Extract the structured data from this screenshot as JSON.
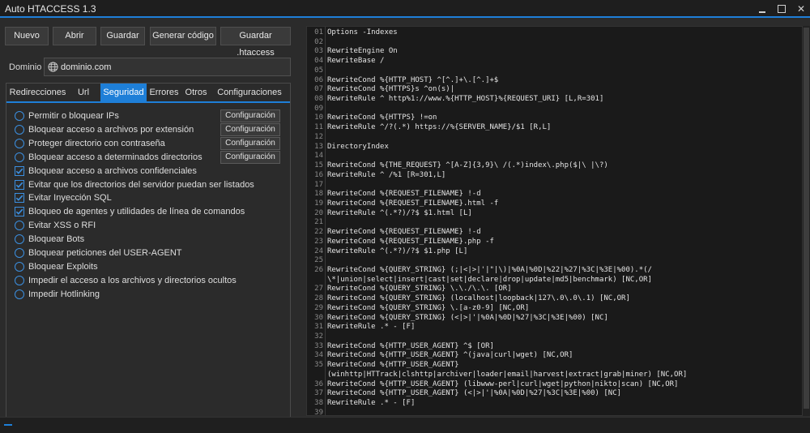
{
  "window": {
    "title": "Auto HTACCESS 1.3"
  },
  "toolbar": {
    "buttons": [
      "Nuevo",
      "Abrir",
      "Guardar",
      "Generar código",
      "Guardar .htaccess"
    ]
  },
  "dominio": {
    "label": "Dominio",
    "value": "dominio.com"
  },
  "tabs": [
    "Redirecciones",
    "Url",
    "Seguridad",
    "Errores",
    "Otros",
    "Configuraciones"
  ],
  "active_tab": "Seguridad",
  "security_options": [
    {
      "label": "Permitir o bloquear IPs",
      "checked": false,
      "config": "Configuración"
    },
    {
      "label": "Bloquear acceso a archivos por extensión",
      "checked": false,
      "config": "Configuración"
    },
    {
      "label": "Proteger directorio con contraseña",
      "checked": false,
      "config": "Configuración"
    },
    {
      "label": "Bloquear acceso a determinados directorios",
      "checked": false,
      "config": "Configuración"
    },
    {
      "label": "Bloquear acceso a archivos confidenciales",
      "checked": true
    },
    {
      "label": "Evitar que los directorios del servidor puedan ser listados",
      "checked": true
    },
    {
      "label": "Evitar Inyección SQL",
      "checked": true
    },
    {
      "label": "Bloqueo de agentes y utilidades de línea de comandos",
      "checked": true
    },
    {
      "label": "Evitar XSS o RFI",
      "checked": false
    },
    {
      "label": "Bloquear Bots",
      "checked": false
    },
    {
      "label": "Bloquear peticiones del USER-AGENT",
      "checked": false
    },
    {
      "label": "Bloquear Exploits",
      "checked": false
    },
    {
      "label": "Impedir el acceso a los archivos y directorios ocultos",
      "checked": false
    },
    {
      "label": "Impedir Hotlinking",
      "checked": false
    }
  ],
  "code_lines": [
    {
      "n": "01",
      "t": "Options -Indexes"
    },
    {
      "n": "02",
      "t": ""
    },
    {
      "n": "03",
      "t": "RewriteEngine On"
    },
    {
      "n": "04",
      "t": "RewriteBase /"
    },
    {
      "n": "05",
      "t": ""
    },
    {
      "n": "06",
      "t": "RewriteCond %{HTTP_HOST} ^[^.]+\\.[^.]+$"
    },
    {
      "n": "07",
      "t": "RewriteCond %{HTTPS}s ^on(s)|"
    },
    {
      "n": "08",
      "t": "RewriteRule ^ http%1://www.%{HTTP_HOST}%{REQUEST_URI} [L,R=301]"
    },
    {
      "n": "09",
      "t": ""
    },
    {
      "n": "10",
      "t": "RewriteCond %{HTTPS} !=on"
    },
    {
      "n": "11",
      "t": "RewriteRule ^/?(.*) https://%{SERVER_NAME}/$1 [R,L]"
    },
    {
      "n": "12",
      "t": ""
    },
    {
      "n": "13",
      "t": "DirectoryIndex"
    },
    {
      "n": "14",
      "t": ""
    },
    {
      "n": "15",
      "t": "RewriteCond %{THE_REQUEST} ^[A-Z]{3,9}\\ /(.*)index\\.php($|\\ |\\?)"
    },
    {
      "n": "16",
      "t": "RewriteRule ^ /%1 [R=301,L]"
    },
    {
      "n": "17",
      "t": ""
    },
    {
      "n": "18",
      "t": "RewriteCond %{REQUEST_FILENAME} !-d"
    },
    {
      "n": "19",
      "t": "RewriteCond %{REQUEST_FILENAME}.html -f"
    },
    {
      "n": "20",
      "t": "RewriteRule ^(.*?)/?$ $1.html [L]"
    },
    {
      "n": "21",
      "t": ""
    },
    {
      "n": "22",
      "t": "RewriteCond %{REQUEST_FILENAME} !-d"
    },
    {
      "n": "23",
      "t": "RewriteCond %{REQUEST_FILENAME}.php -f"
    },
    {
      "n": "24",
      "t": "RewriteRule ^(.*?)/?$ $1.php [L]"
    },
    {
      "n": "25",
      "t": ""
    },
    {
      "n": "26",
      "t": "RewriteCond %{QUERY_STRING} (;|<|>|'|\"|\\)|%0A|%0D|%22|%27|%3C|%3E|%00).*(/"
    },
    {
      "n": "",
      "t": "\\*|union|select|insert|cast|set|declare|drop|update|md5|benchmark) [NC,OR]"
    },
    {
      "n": "27",
      "t": "RewriteCond %{QUERY_STRING} \\.\\./\\.\\. [OR]"
    },
    {
      "n": "28",
      "t": "RewriteCond %{QUERY_STRING} (localhost|loopback|127\\.0\\.0\\.1) [NC,OR]"
    },
    {
      "n": "29",
      "t": "RewriteCond %{QUERY_STRING} \\.[a-z0-9] [NC,OR]"
    },
    {
      "n": "30",
      "t": "RewriteCond %{QUERY_STRING} (<|>|'|%0A|%0D|%27|%3C|%3E|%00) [NC]"
    },
    {
      "n": "31",
      "t": "RewriteRule .* - [F]"
    },
    {
      "n": "32",
      "t": ""
    },
    {
      "n": "33",
      "t": "RewriteCond %{HTTP_USER_AGENT} ^$ [OR]"
    },
    {
      "n": "34",
      "t": "RewriteCond %{HTTP_USER_AGENT} ^(java|curl|wget) [NC,OR]"
    },
    {
      "n": "35",
      "t": "RewriteCond %{HTTP_USER_AGENT}"
    },
    {
      "n": "",
      "t": "(winhttp|HTTrack|clshttp|archiver|loader|email|harvest|extract|grab|miner) [NC,OR]"
    },
    {
      "n": "36",
      "t": "RewriteCond %{HTTP_USER_AGENT} (libwww-perl|curl|wget|python|nikto|scan) [NC,OR]"
    },
    {
      "n": "37",
      "t": "RewriteCond %{HTTP_USER_AGENT} (<|>|'|%0A|%0D|%27|%3C|%3E|%00) [NC]"
    },
    {
      "n": "38",
      "t": "RewriteRule .* - [F]"
    },
    {
      "n": "39",
      "t": ""
    }
  ],
  "colors": {
    "accent": "#1e7fd8",
    "background": "#2b2b2b",
    "editor_bg": "#1a1a1a"
  }
}
